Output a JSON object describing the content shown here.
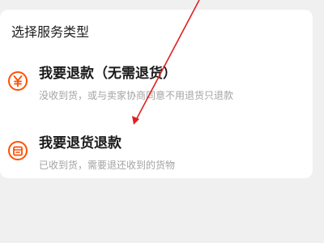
{
  "section": {
    "title": "选择服务类型"
  },
  "options": [
    {
      "icon": "yen-coin-icon",
      "title": "我要退款（无需退货）",
      "description": "没收到货，或与卖家协商同意不用退货只退款"
    },
    {
      "icon": "package-return-icon",
      "title": "我要退货退款",
      "description": "已收到货，需要退还收到的货物"
    }
  ],
  "colors": {
    "accent": "#ff5000",
    "annotation": "#e02020",
    "background": "#f0f0f0",
    "card": "#ffffff"
  }
}
